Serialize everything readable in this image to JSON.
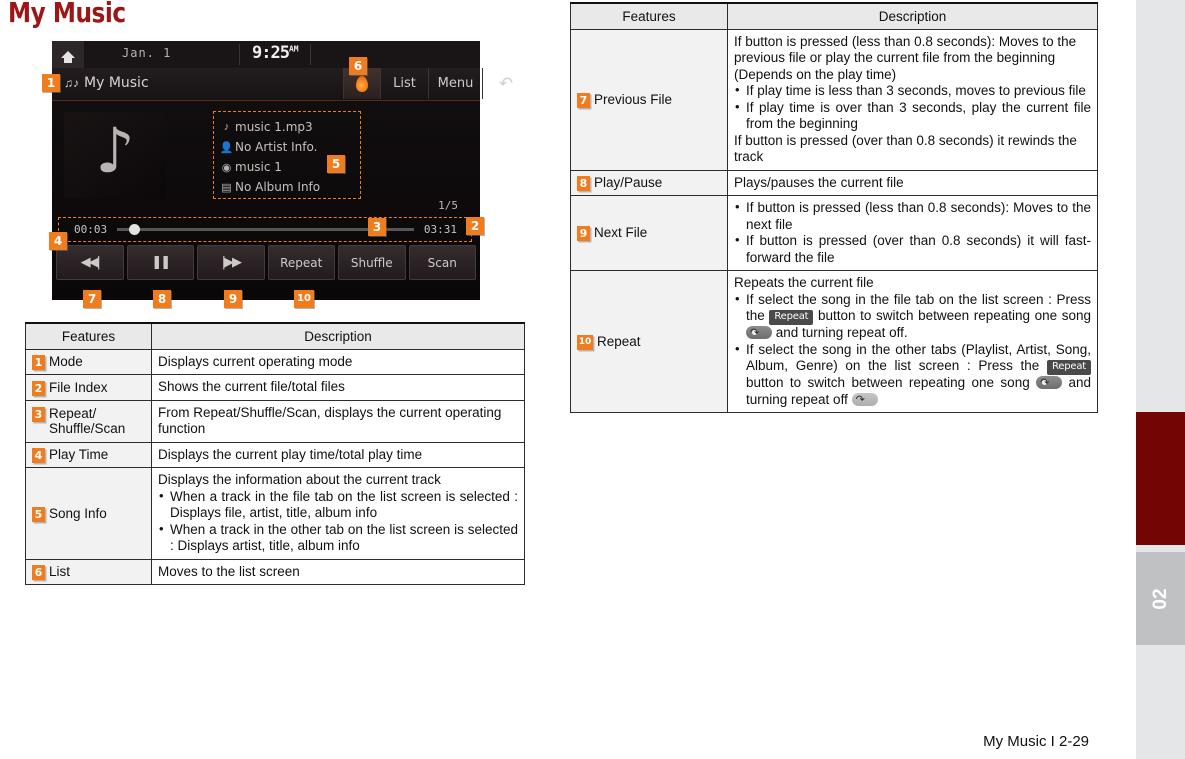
{
  "page": {
    "title": "My Music",
    "footer": "My Music I 2-29",
    "chapter_number": "02"
  },
  "device": {
    "status": {
      "home_icon": "home-icon",
      "date": "Jan.  1",
      "time": "9:25",
      "ampm": "AM"
    },
    "titlebar": {
      "mode_icon": "music-note-folder-icon",
      "mode_label": "My Music",
      "jukebox_icon": "jukebox-icon",
      "list_label": "List",
      "menu_label": "Menu",
      "back_icon": "back-arrow-icon"
    },
    "album_art_icon": "music-note-icon",
    "song_info": [
      {
        "icon": "file-note-icon",
        "text": "music 1.mp3"
      },
      {
        "icon": "artist-icon",
        "text": "No Artist Info."
      },
      {
        "icon": "title-icon",
        "text": "music 1"
      },
      {
        "icon": "album-icon",
        "text": "No Album Info"
      }
    ],
    "file_index": "1/5",
    "progress": {
      "current_time": "00:03",
      "total_time": "03:31"
    },
    "buttons": [
      {
        "name": "previous-file-button",
        "glyph": "⏮",
        "label": ""
      },
      {
        "name": "play-pause-button",
        "glyph": "⏸",
        "label": ""
      },
      {
        "name": "next-file-button",
        "glyph": "⏭",
        "label": ""
      },
      {
        "name": "repeat-button",
        "glyph": "",
        "label": "Repeat"
      },
      {
        "name": "shuffle-button",
        "glyph": "",
        "label": "Shuffle"
      },
      {
        "name": "scan-button",
        "glyph": "",
        "label": "Scan"
      }
    ],
    "callouts": [
      "1",
      "2",
      "3",
      "4",
      "5",
      "6",
      "7",
      "8",
      "9",
      "10"
    ]
  },
  "left_table": {
    "headers": {
      "features": "Features",
      "description": "Description"
    },
    "rows": [
      {
        "num": "1",
        "feature": "Mode",
        "description": "Displays current operating mode"
      },
      {
        "num": "2",
        "feature": "File Index",
        "description": "Shows the current file/total files"
      },
      {
        "num": "3",
        "feature": "Repeat/\nShuffle/Scan",
        "description": "From Repeat/Shuffle/Scan, displays the current operating function"
      },
      {
        "num": "4",
        "feature": "Play Time",
        "description": "Displays the current play time/total play time"
      },
      {
        "num": "5",
        "feature": "Song Info",
        "description_intro": "Displays the information about the current track",
        "bullets": [
          "When a track in the file tab on the list screen is selected : Displays file, artist, title, album info",
          "When a track in the other tab on the list screen is selected : Displays artist, title, album info"
        ]
      },
      {
        "num": "6",
        "feature": "List",
        "description": "Moves to the list screen"
      }
    ]
  },
  "right_table": {
    "headers": {
      "features": "Features",
      "description": "Description"
    },
    "rows": [
      {
        "num": "7",
        "feature": "Previous File",
        "intro": "If button is pressed (less than 0.8 seconds): Moves to the previous file or play the current file from the beginning (Depends on the play time)",
        "bullets": [
          "If play time is less than 3 seconds, moves to previous file",
          "If play time is over than 3 seconds, play the current file from the beginning"
        ],
        "outro": "If button is pressed (over than 0.8 seconds) it rewinds the track"
      },
      {
        "num": "8",
        "feature": "Play/Pause",
        "description": "Plays/pauses the current file"
      },
      {
        "num": "9",
        "feature": "Next File",
        "bullets": [
          "If button is pressed (less than 0.8 seconds): Moves to the next file",
          "If button is pressed (over than 0.8 seconds) it will fast-forward the file"
        ]
      },
      {
        "num": "10",
        "feature": "Repeat",
        "intro": "Repeats the current file",
        "bullet1": {
          "part_a": "If select the song in the file tab on the list screen : Press the ",
          "chip": "Repeat",
          "part_b": " button to switch between repeating one song ",
          "icon": "repeat-one-icon",
          "part_c": " and turning repeat off."
        },
        "bullet2": {
          "part_a": "If select the song in the other tabs (Playlist, Artist, Song, Album, Genre) on the list screen : Press the ",
          "chip": "Repeat",
          "part_b": " button to switch between repeating one song ",
          "icon": "repeat-one-icon",
          "part_c": " and turning repeat off ",
          "icon2": "repeat-off-icon"
        }
      }
    ]
  },
  "colors": {
    "title_red": "#9e1515",
    "badge_orange": "#f07c1e",
    "rail_active": "#730505",
    "rail_chapter": "#bfc1c3",
    "rail_bg": "#e4e6e8"
  }
}
